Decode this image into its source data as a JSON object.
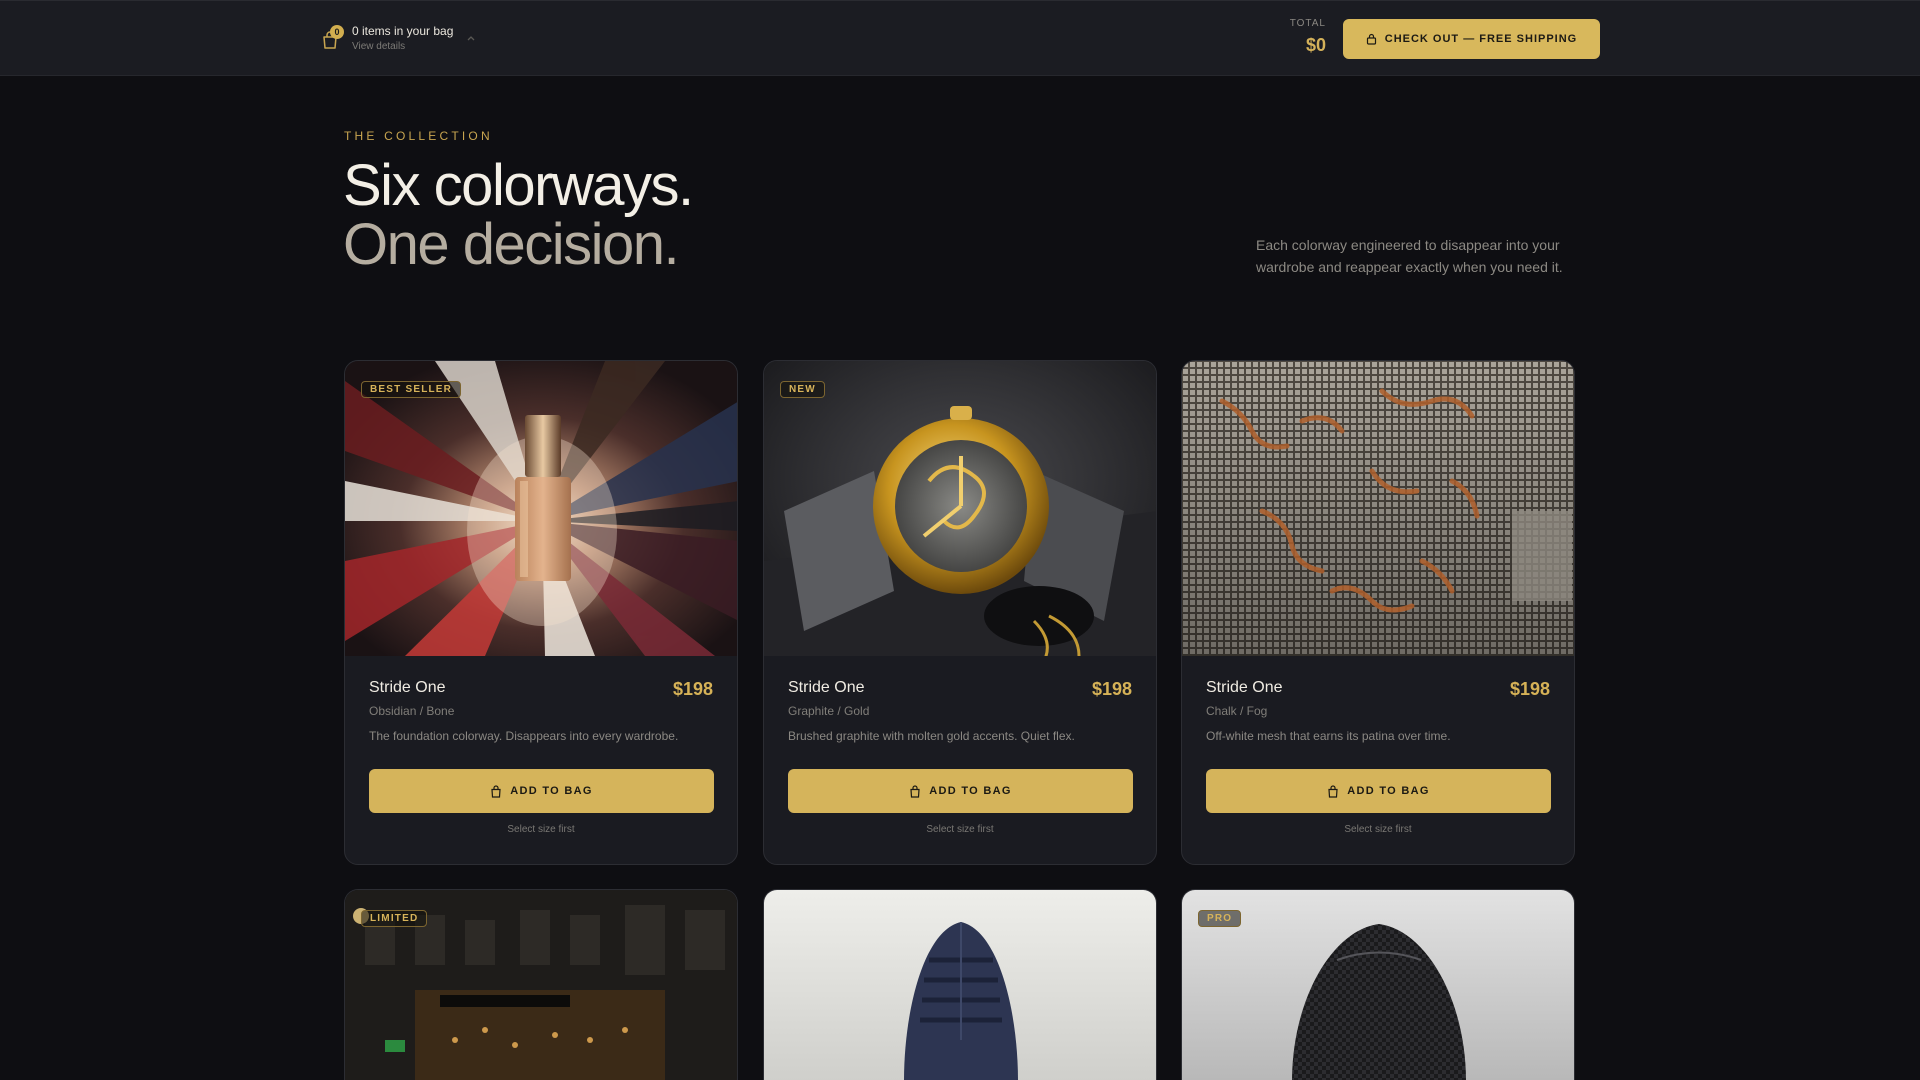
{
  "topbar": {
    "bag_count": "0",
    "bag_title": "0 items in your bag",
    "bag_subtitle": "View details",
    "total_label": "TOTAL",
    "total_value": "$0",
    "checkout_label": "CHECK OUT — FREE SHIPPING"
  },
  "hero": {
    "eyebrow": "THE COLLECTION",
    "headline_line1": "Six colorways.",
    "headline_line2": "One decision.",
    "intro": "Each colorway engineered to disappear into your wardrobe and reappear exactly when you need it."
  },
  "colors": {
    "accent": "#d5b45b",
    "background": "#0e0e12",
    "card": "#1a1b21"
  },
  "products": [
    {
      "badge": "BEST SELLER",
      "name": "Stride One",
      "price": "$198",
      "colorway": "Obsidian / Bone",
      "description": "The foundation colorway. Disappears into every wardrobe.",
      "button": "ADD TO BAG",
      "hint": "Select size first"
    },
    {
      "badge": "NEW",
      "name": "Stride One",
      "price": "$198",
      "colorway": "Graphite / Gold",
      "description": "Brushed graphite with molten gold accents. Quiet flex.",
      "button": "ADD TO BAG",
      "hint": "Select size first"
    },
    {
      "badge": "",
      "name": "Stride One",
      "price": "$198",
      "colorway": "Chalk / Fog",
      "description": "Off-white mesh that earns its patina over time.",
      "button": "ADD TO BAG",
      "hint": "Select size first"
    },
    {
      "badge": "LIMITED"
    },
    {
      "badge": ""
    },
    {
      "badge": "PRO"
    }
  ]
}
